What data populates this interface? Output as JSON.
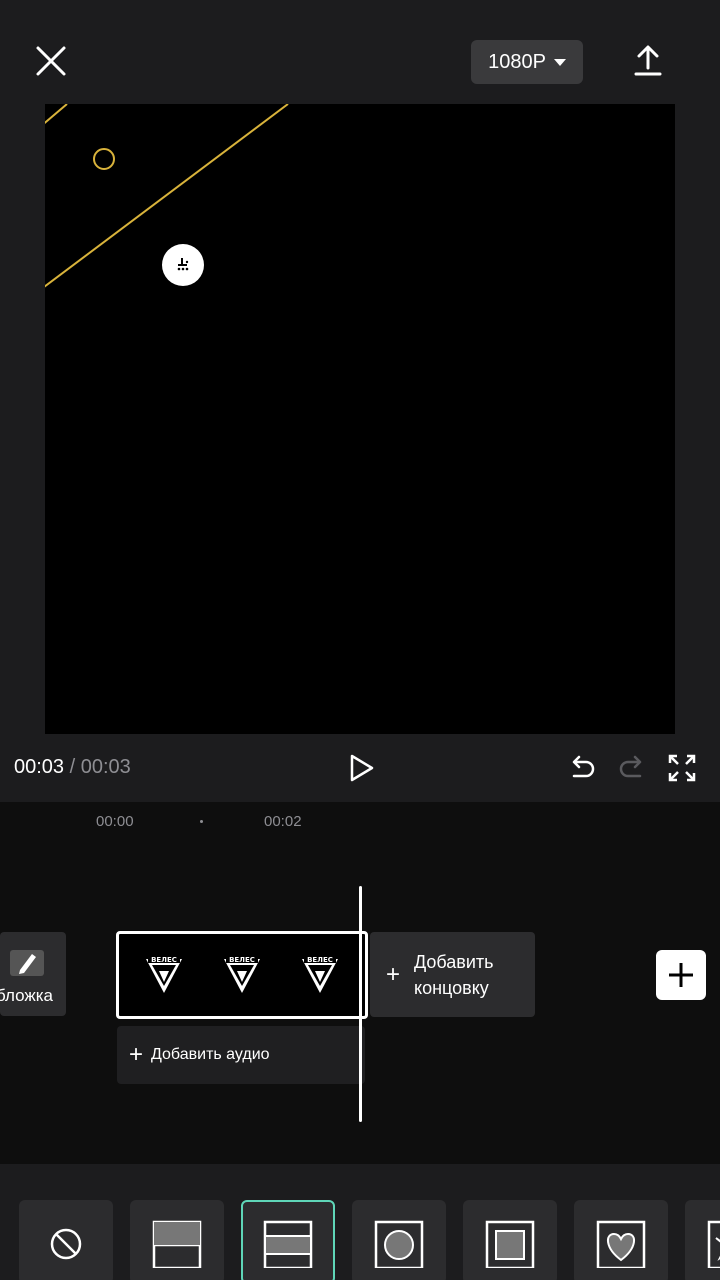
{
  "header": {
    "resolution_label": "1080P"
  },
  "playback": {
    "current_time": "00:03",
    "separator": "/",
    "total_time": "00:03"
  },
  "timeline": {
    "ruler": [
      "00:00",
      "00:02"
    ],
    "cover_label": "бложка",
    "clip_logo_text": "ВЕЛЕС",
    "add_ending_label": "Добавить концовку",
    "add_audio_label": "Добавить аудио"
  },
  "mask_tools": [
    {
      "name": "none-mask-icon",
      "selected": false
    },
    {
      "name": "linear-mask-icon",
      "selected": false
    },
    {
      "name": "mirror-mask-icon",
      "selected": true
    },
    {
      "name": "circle-mask-icon",
      "selected": false
    },
    {
      "name": "rectangle-mask-icon",
      "selected": false
    },
    {
      "name": "heart-mask-icon",
      "selected": false
    },
    {
      "name": "star-mask-icon",
      "selected": false
    }
  ],
  "colors": {
    "accent_gold": "#d9b33b",
    "selected_outline": "#5fd6b8"
  }
}
